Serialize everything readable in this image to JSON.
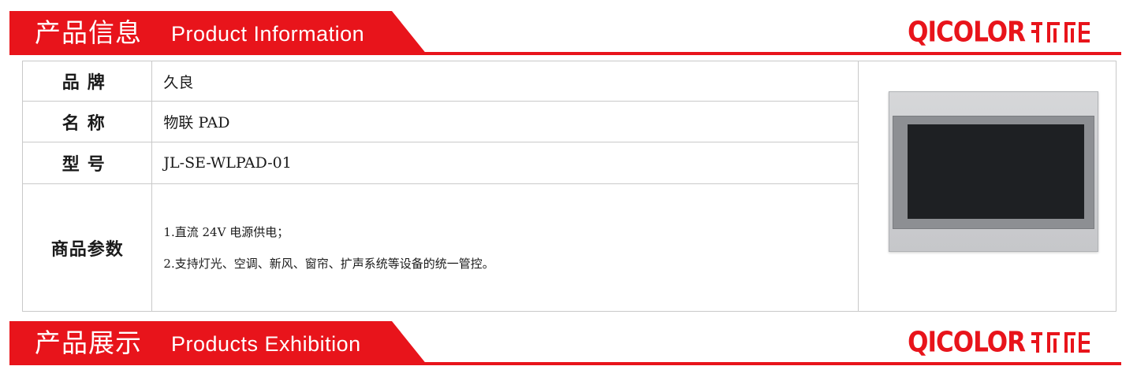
{
  "top_banner": {
    "title_cn": "产品信息",
    "title_en": "Product Information",
    "logo_text": "QICOLOR",
    "logo_mark_icon": "qicolor-chinese-wordmark"
  },
  "product_info": {
    "rows": [
      {
        "label": "品牌",
        "value": "久良"
      },
      {
        "label": "名称",
        "value": "物联 PAD"
      },
      {
        "label": "型号",
        "value": "JL-SE-WLPAD-01"
      }
    ],
    "params_label": "商品参数",
    "params": [
      "1.直流 24V 电源供电；",
      "2.支持灯光、空调、新风、窗帘、扩声系统等设备的统一管控。"
    ],
    "image_icon": "touch-panel-pad-photo"
  },
  "bottom_banner": {
    "title_cn": "产品展示",
    "title_en": "Products Exhibition",
    "logo_text": "QICOLOR",
    "logo_mark_icon": "qicolor-chinese-wordmark"
  },
  "colors": {
    "brand_red": "#e8141b",
    "border_gray": "#c9c9c9"
  }
}
